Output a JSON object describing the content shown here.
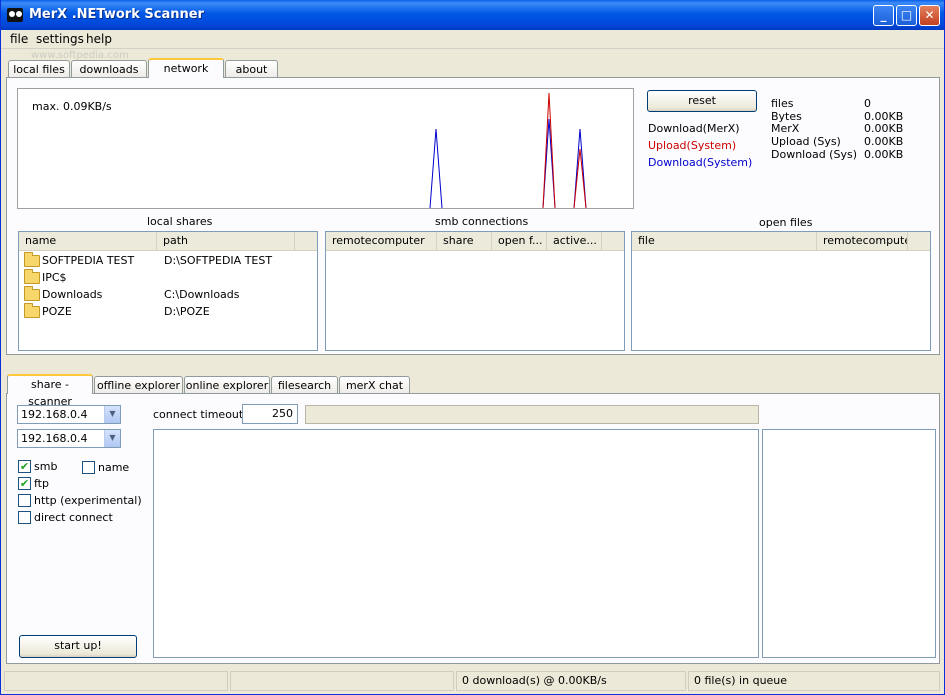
{
  "window": {
    "title": "MerX .NETwork Scanner"
  },
  "titlebar_buttons": {
    "minimize": "_",
    "maximize": "□",
    "close": "✕"
  },
  "menu": [
    "file",
    "settings",
    "help"
  ],
  "top_tabs": [
    "local files",
    "downloads",
    "network",
    "about"
  ],
  "watermark": "www.softpedia.com",
  "graph": {
    "max_label": "max. 0.09KB/s",
    "series_colors": {
      "download_merx": "#000000",
      "upload_system": "#cc0000",
      "download_system": "#0000cc"
    }
  },
  "reset_button": "reset",
  "legend": {
    "download_merx": "Download(MerX)",
    "upload_system": "Upload(System)",
    "download_system": "Download(System)"
  },
  "stats": [
    {
      "label": "files",
      "value": "0"
    },
    {
      "label": "Bytes",
      "value": "0.00KB"
    },
    {
      "label": "MerX",
      "value": "0.00KB"
    },
    {
      "label": "Upload (Sys)",
      "value": "0.00KB"
    },
    {
      "label": "Download (Sys)",
      "value": "0.00KB"
    }
  ],
  "local_shares": {
    "title": "local shares",
    "columns": [
      "name",
      "path"
    ],
    "rows": [
      {
        "name": "SOFTPEDIA TEST",
        "path": "D:\\SOFTPEDIA TEST"
      },
      {
        "name": "IPC$",
        "path": ""
      },
      {
        "name": "Downloads",
        "path": "C:\\Downloads"
      },
      {
        "name": "POZE",
        "path": "D:\\POZE"
      }
    ]
  },
  "smb_connections": {
    "title": "smb connections",
    "columns": [
      "remotecomputer",
      "share",
      "open f...",
      "active..."
    ]
  },
  "open_files": {
    "title": "open files",
    "columns": [
      "file",
      "remotecomputer"
    ]
  },
  "bottom_tabs": [
    "share - scanner",
    "offline explorer",
    "online explorer",
    "filesearch",
    "merX chat"
  ],
  "scanner": {
    "ip_from": "192.168.0.4",
    "ip_to": "192.168.0.4",
    "timeout_label": "connect timeout:",
    "timeout_value": "250",
    "checks": [
      {
        "label": "smb",
        "checked": "✔"
      },
      {
        "label": "name",
        "checked": ""
      },
      {
        "label": "ftp",
        "checked": "✔"
      },
      {
        "label": "http (experimental)",
        "checked": ""
      },
      {
        "label": "direct connect",
        "checked": ""
      }
    ],
    "start_button": "start up!"
  },
  "status": {
    "downloads": "0 download(s) @ 0.00KB/s",
    "queue": "0 file(s) in queue"
  }
}
